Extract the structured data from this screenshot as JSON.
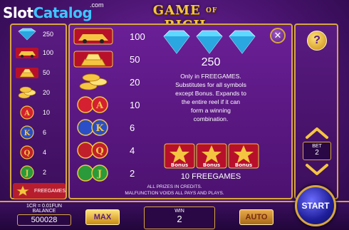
{
  "logo": {
    "part1": "Slot",
    "part2": "Catalog",
    "suffix": ".com"
  },
  "game_title": {
    "left": "GAME",
    "of": "OF",
    "right": "RICH"
  },
  "small_symbols": [
    {
      "icon": "diamond-icon",
      "value": "250"
    },
    {
      "icon": "car-icon",
      "value": "100"
    },
    {
      "icon": "gold-bars-icon",
      "value": "50"
    },
    {
      "icon": "coins-stack-icon",
      "value": "20"
    },
    {
      "icon": "ace-icon",
      "value": "10"
    },
    {
      "icon": "king-icon",
      "value": "6"
    },
    {
      "icon": "queen-icon",
      "value": "4"
    },
    {
      "icon": "jack-icon",
      "value": "2"
    }
  ],
  "small_freegames": {
    "icon": "bonus-star-icon",
    "label": "FREEGAMES"
  },
  "paytable": [
    {
      "icon": "car-icon",
      "value": "100"
    },
    {
      "icon": "gold-bars-icon",
      "value": "50"
    },
    {
      "icon": "coins-stack-icon",
      "value": "20"
    },
    {
      "icon": "ace-icon",
      "value": "10"
    },
    {
      "icon": "king-icon",
      "value": "6"
    },
    {
      "icon": "queen-icon",
      "value": "4"
    },
    {
      "icon": "jack-icon",
      "value": "2"
    }
  ],
  "wild": {
    "value": "250",
    "desc_lines": [
      "Only in FREEGAMES.",
      "Substitutes for all symbols",
      "except Bonus. Expands to",
      "the entire reel if it can",
      "form a winning",
      "combination."
    ]
  },
  "bonus": {
    "label": "Bonus",
    "freegames": "10 FREEGAMES"
  },
  "info_lines": [
    "ALL PRIZES IN CREDITS.",
    "MALFUNCTION VOIDS ALL PAYS AND PLAYS."
  ],
  "right_panel": {
    "help": "?",
    "bet_label": "BET",
    "bet_value": "2"
  },
  "bottom": {
    "coin_rate": "1CR = 0.01FUN",
    "balance_label": "BALANCE",
    "balance_value": "500028",
    "max_label": "MAX",
    "win_label": "WIN",
    "win_value": "2",
    "auto_label": "AUTO",
    "start_label": "START"
  },
  "colors": {
    "gold": "#d8a640",
    "purple": "#5a1b82",
    "diamond": "#5fd8ff",
    "bonus_red": "#b81d2e"
  }
}
